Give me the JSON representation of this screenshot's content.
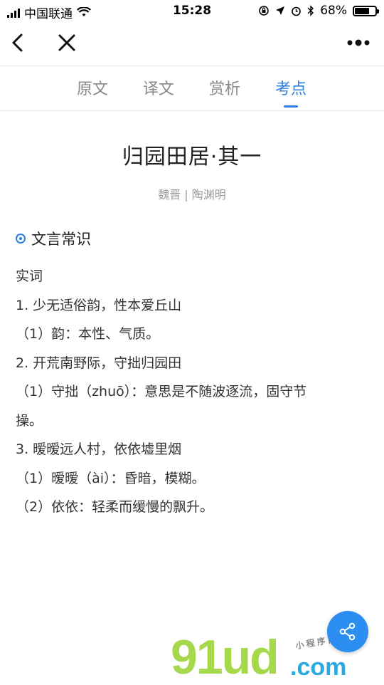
{
  "status_bar": {
    "carrier": "中国联通",
    "time": "15:28",
    "battery": "68%",
    "battery_level": 0.68
  },
  "nav": {
    "back_icon": "chevron-left-icon",
    "close_icon": "close-icon",
    "more_icon": "more-dots-icon"
  },
  "tabs": [
    {
      "label": "原文",
      "active": false
    },
    {
      "label": "译文",
      "active": false
    },
    {
      "label": "赏析",
      "active": false
    },
    {
      "label": "考点",
      "active": true
    }
  ],
  "article": {
    "title": "归园田居·其一",
    "meta": "魏晋 | 陶渊明"
  },
  "section": {
    "heading": "文言常识",
    "lines": [
      "实词",
      "1. 少无适俗韵，性本爱丘山",
      "（1）韵：本性、气质。",
      "2. 开荒南野际，守拙归园田",
      "（1）守拙（zhuō）：意思是不随波逐流，固守节",
      "操。",
      "3. 暧暧远人村，依依墟里烟",
      "（1）暧暧（ài）：昏暗，模糊。",
      "（2）依依：轻柔而缓慢的飘升。"
    ]
  },
  "fab": {
    "icon": "share-icon"
  },
  "watermark": {
    "main": "91ud",
    "domain": ".com",
    "script": "小 程 序 商 店"
  },
  "colors": {
    "accent": "#2b7fdf",
    "fab": "#2b8ef0",
    "text": "#333333",
    "muted": "#9a9a9a"
  }
}
